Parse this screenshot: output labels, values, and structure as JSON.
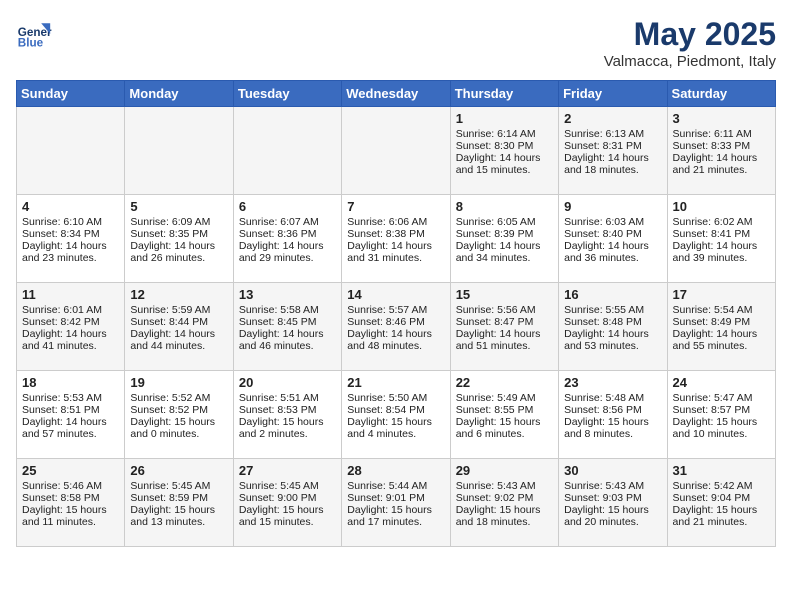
{
  "header": {
    "logo_line1": "General",
    "logo_line2": "Blue",
    "month": "May 2025",
    "location": "Valmacca, Piedmont, Italy"
  },
  "days_of_week": [
    "Sunday",
    "Monday",
    "Tuesday",
    "Wednesday",
    "Thursday",
    "Friday",
    "Saturday"
  ],
  "weeks": [
    [
      {
        "day": "",
        "info": ""
      },
      {
        "day": "",
        "info": ""
      },
      {
        "day": "",
        "info": ""
      },
      {
        "day": "",
        "info": ""
      },
      {
        "day": "1",
        "info": "Sunrise: 6:14 AM\nSunset: 8:30 PM\nDaylight: 14 hours\nand 15 minutes."
      },
      {
        "day": "2",
        "info": "Sunrise: 6:13 AM\nSunset: 8:31 PM\nDaylight: 14 hours\nand 18 minutes."
      },
      {
        "day": "3",
        "info": "Sunrise: 6:11 AM\nSunset: 8:33 PM\nDaylight: 14 hours\nand 21 minutes."
      }
    ],
    [
      {
        "day": "4",
        "info": "Sunrise: 6:10 AM\nSunset: 8:34 PM\nDaylight: 14 hours\nand 23 minutes."
      },
      {
        "day": "5",
        "info": "Sunrise: 6:09 AM\nSunset: 8:35 PM\nDaylight: 14 hours\nand 26 minutes."
      },
      {
        "day": "6",
        "info": "Sunrise: 6:07 AM\nSunset: 8:36 PM\nDaylight: 14 hours\nand 29 minutes."
      },
      {
        "day": "7",
        "info": "Sunrise: 6:06 AM\nSunset: 8:38 PM\nDaylight: 14 hours\nand 31 minutes."
      },
      {
        "day": "8",
        "info": "Sunrise: 6:05 AM\nSunset: 8:39 PM\nDaylight: 14 hours\nand 34 minutes."
      },
      {
        "day": "9",
        "info": "Sunrise: 6:03 AM\nSunset: 8:40 PM\nDaylight: 14 hours\nand 36 minutes."
      },
      {
        "day": "10",
        "info": "Sunrise: 6:02 AM\nSunset: 8:41 PM\nDaylight: 14 hours\nand 39 minutes."
      }
    ],
    [
      {
        "day": "11",
        "info": "Sunrise: 6:01 AM\nSunset: 8:42 PM\nDaylight: 14 hours\nand 41 minutes."
      },
      {
        "day": "12",
        "info": "Sunrise: 5:59 AM\nSunset: 8:44 PM\nDaylight: 14 hours\nand 44 minutes."
      },
      {
        "day": "13",
        "info": "Sunrise: 5:58 AM\nSunset: 8:45 PM\nDaylight: 14 hours\nand 46 minutes."
      },
      {
        "day": "14",
        "info": "Sunrise: 5:57 AM\nSunset: 8:46 PM\nDaylight: 14 hours\nand 48 minutes."
      },
      {
        "day": "15",
        "info": "Sunrise: 5:56 AM\nSunset: 8:47 PM\nDaylight: 14 hours\nand 51 minutes."
      },
      {
        "day": "16",
        "info": "Sunrise: 5:55 AM\nSunset: 8:48 PM\nDaylight: 14 hours\nand 53 minutes."
      },
      {
        "day": "17",
        "info": "Sunrise: 5:54 AM\nSunset: 8:49 PM\nDaylight: 14 hours\nand 55 minutes."
      }
    ],
    [
      {
        "day": "18",
        "info": "Sunrise: 5:53 AM\nSunset: 8:51 PM\nDaylight: 14 hours\nand 57 minutes."
      },
      {
        "day": "19",
        "info": "Sunrise: 5:52 AM\nSunset: 8:52 PM\nDaylight: 15 hours\nand 0 minutes."
      },
      {
        "day": "20",
        "info": "Sunrise: 5:51 AM\nSunset: 8:53 PM\nDaylight: 15 hours\nand 2 minutes."
      },
      {
        "day": "21",
        "info": "Sunrise: 5:50 AM\nSunset: 8:54 PM\nDaylight: 15 hours\nand 4 minutes."
      },
      {
        "day": "22",
        "info": "Sunrise: 5:49 AM\nSunset: 8:55 PM\nDaylight: 15 hours\nand 6 minutes."
      },
      {
        "day": "23",
        "info": "Sunrise: 5:48 AM\nSunset: 8:56 PM\nDaylight: 15 hours\nand 8 minutes."
      },
      {
        "day": "24",
        "info": "Sunrise: 5:47 AM\nSunset: 8:57 PM\nDaylight: 15 hours\nand 10 minutes."
      }
    ],
    [
      {
        "day": "25",
        "info": "Sunrise: 5:46 AM\nSunset: 8:58 PM\nDaylight: 15 hours\nand 11 minutes."
      },
      {
        "day": "26",
        "info": "Sunrise: 5:45 AM\nSunset: 8:59 PM\nDaylight: 15 hours\nand 13 minutes."
      },
      {
        "day": "27",
        "info": "Sunrise: 5:45 AM\nSunset: 9:00 PM\nDaylight: 15 hours\nand 15 minutes."
      },
      {
        "day": "28",
        "info": "Sunrise: 5:44 AM\nSunset: 9:01 PM\nDaylight: 15 hours\nand 17 minutes."
      },
      {
        "day": "29",
        "info": "Sunrise: 5:43 AM\nSunset: 9:02 PM\nDaylight: 15 hours\nand 18 minutes."
      },
      {
        "day": "30",
        "info": "Sunrise: 5:43 AM\nSunset: 9:03 PM\nDaylight: 15 hours\nand 20 minutes."
      },
      {
        "day": "31",
        "info": "Sunrise: 5:42 AM\nSunset: 9:04 PM\nDaylight: 15 hours\nand 21 minutes."
      }
    ]
  ]
}
